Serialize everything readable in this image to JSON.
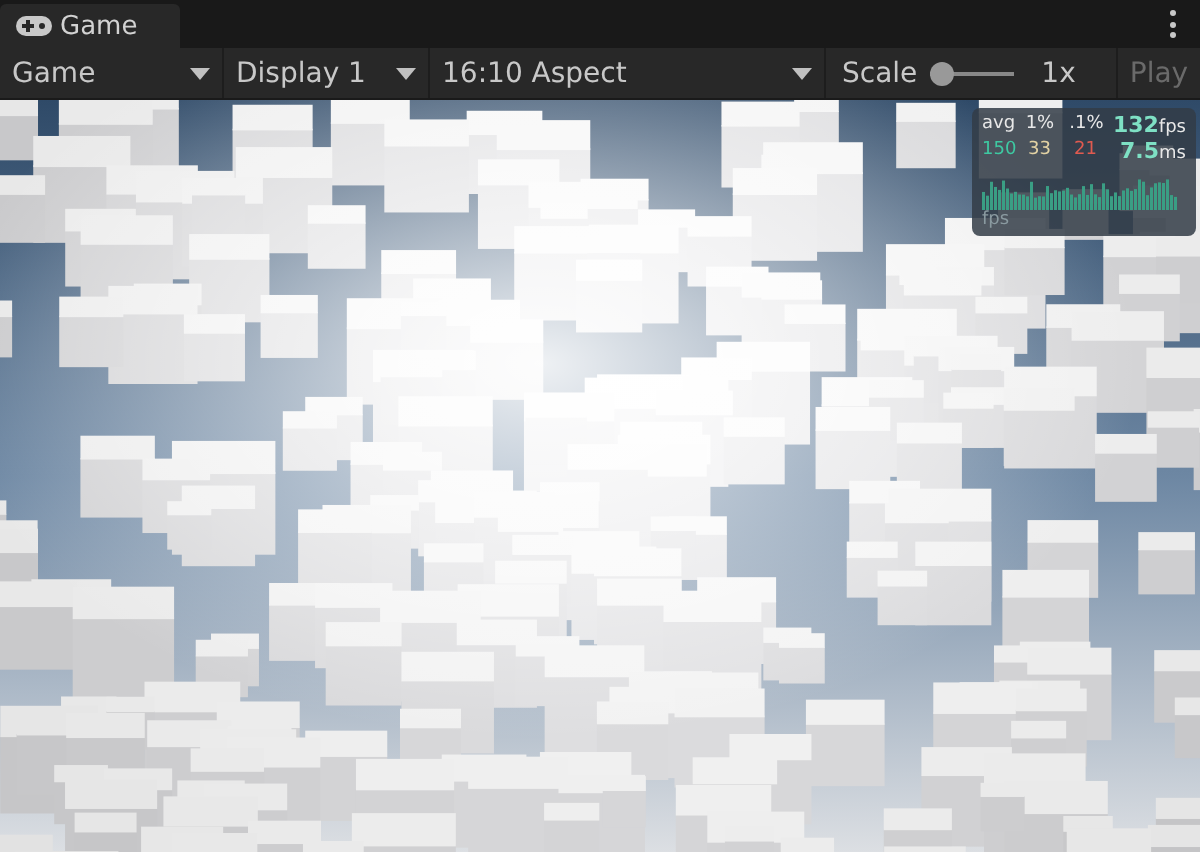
{
  "tab": {
    "title": "Game",
    "selected": true
  },
  "toolbar": {
    "dropdowns": [
      {
        "label": "Game"
      },
      {
        "label": "Display 1"
      },
      {
        "label": "16:10 Aspect"
      }
    ],
    "scale": {
      "label": "Scale",
      "level": 0,
      "reading": "1x"
    },
    "play_button": {
      "label": "Play",
      "disabled": true
    }
  },
  "stats_overlay": {
    "headers": [
      "avg",
      "1%",
      ".1%"
    ],
    "values": [
      {
        "text": "150",
        "color": "#3ec9a2"
      },
      {
        "text": "33",
        "color": "#e2d2a4"
      },
      {
        "text": "21",
        "color": "#e05a50"
      }
    ],
    "fps": {
      "value": "132",
      "unit": "fps"
    },
    "ms": {
      "value": "7.5",
      "unit": "ms"
    },
    "graph_label": "fps"
  }
}
